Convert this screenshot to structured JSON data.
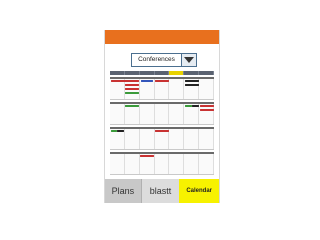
{
  "selector": {
    "value": "Conferences",
    "icon": "dropdown-arrow-icon"
  },
  "tabs": [
    {
      "label": "Plans"
    },
    {
      "label": "blastt"
    },
    {
      "label": "Calendar"
    }
  ],
  "colors": {
    "header": "#e8701e",
    "active_tab": "#f7f200",
    "event_red": "#c83232",
    "event_green": "#3a9a3a",
    "event_dark": "#222222",
    "event_blue": "#3355bb"
  }
}
